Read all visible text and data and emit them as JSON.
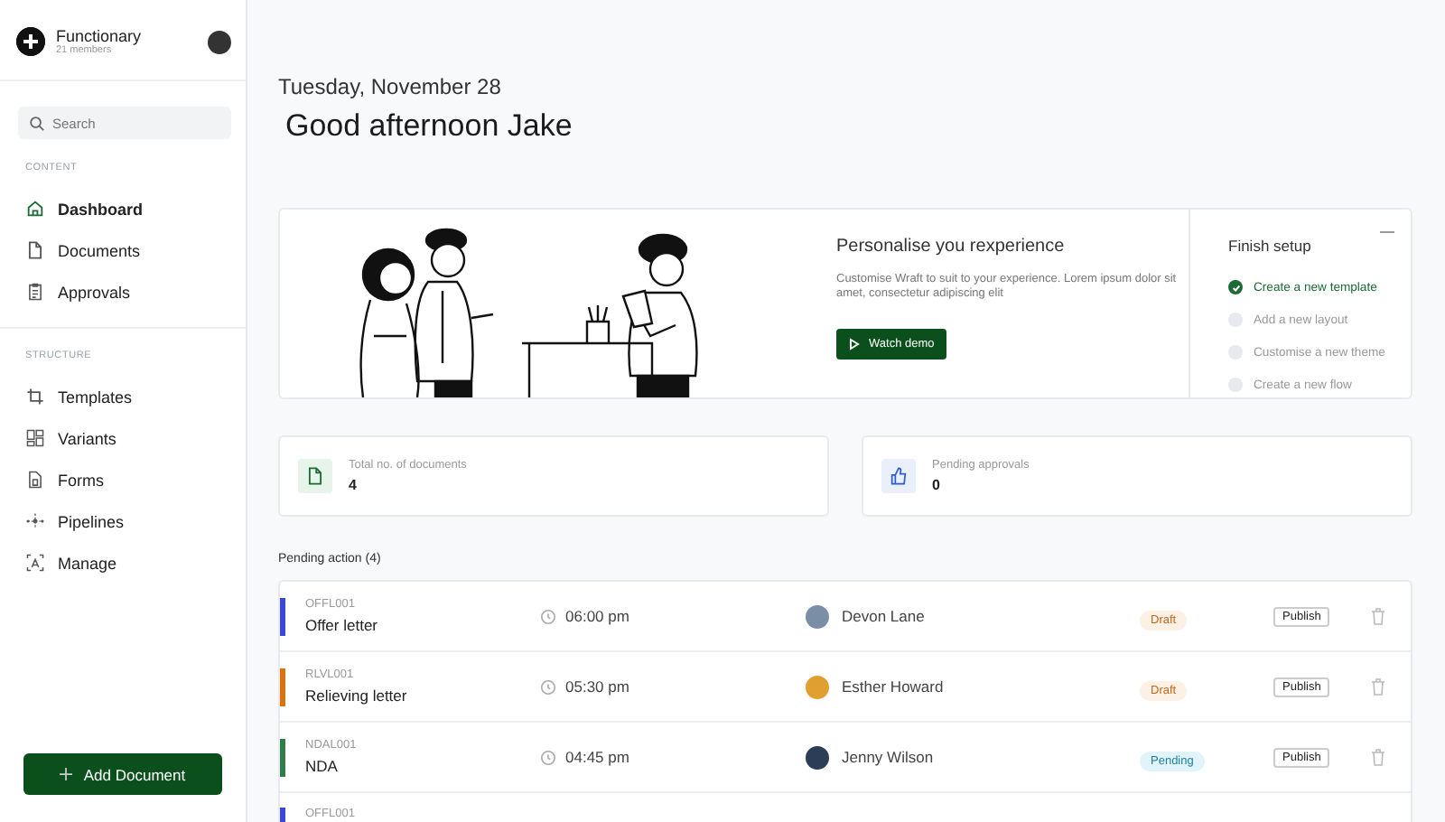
{
  "workspace": {
    "name": "Functionary",
    "members": "21 members"
  },
  "search": {
    "placeholder": "Search"
  },
  "nav_sections": [
    {
      "heading": "CONTENT",
      "items": [
        {
          "label": "Dashboard",
          "selected": true
        },
        {
          "label": "Documents",
          "selected": false
        },
        {
          "label": "Approvals",
          "selected": false
        }
      ]
    },
    {
      "heading": "STRUCTURE",
      "items": [
        {
          "label": "Templates",
          "selected": false
        },
        {
          "label": "Variants",
          "selected": false
        },
        {
          "label": "Forms",
          "selected": false
        },
        {
          "label": "Pipelines",
          "selected": false
        },
        {
          "label": "Manage",
          "selected": false
        }
      ]
    }
  ],
  "add_button": {
    "label": "Add Document"
  },
  "date": "Tuesday, November 28",
  "greeting": "Good afternoon Jake",
  "banner": {
    "title": "Personalise you rexperience",
    "text": "Customise Wraft to suit to your experience. Lorem ipsum dolor sit amet, consectetur adipiscing elit",
    "button": "Watch demo"
  },
  "setup": {
    "title": "Finish setup",
    "steps": [
      {
        "label": "Create a new template",
        "checked": true
      },
      {
        "label": "Add a new layout",
        "checked": false
      },
      {
        "label": "Customise a new theme",
        "checked": false
      },
      {
        "label": "Create a new flow",
        "checked": false
      }
    ]
  },
  "stats": [
    {
      "label": "Total no. of documents",
      "value": "4"
    },
    {
      "label": "Pending approvals",
      "value": "0"
    }
  ],
  "pending_heading": "Pending action (4)",
  "rows": [
    {
      "code": "OFFL001",
      "title": "Offer letter",
      "color": "#3b45d6",
      "time": "06:00 pm",
      "person": "Devon Lane",
      "status": {
        "label": "Draft",
        "kind": "draft"
      },
      "action": "Publish"
    },
    {
      "code": "RLVL001",
      "title": "Relieving letter",
      "color": "#d9730d",
      "time": "05:30 pm",
      "person": "Esther Howard",
      "status": {
        "label": "Draft",
        "kind": "draft"
      },
      "action": "Publish"
    },
    {
      "code": "NDAL001",
      "title": "NDA",
      "color": "#2f7d4a",
      "time": "04:45 pm",
      "person": "Jenny Wilson",
      "status": {
        "label": "Pending",
        "kind": "pending"
      },
      "action": "Publish"
    },
    {
      "code": "OFFL001",
      "color": "#3b45d6"
    }
  ]
}
